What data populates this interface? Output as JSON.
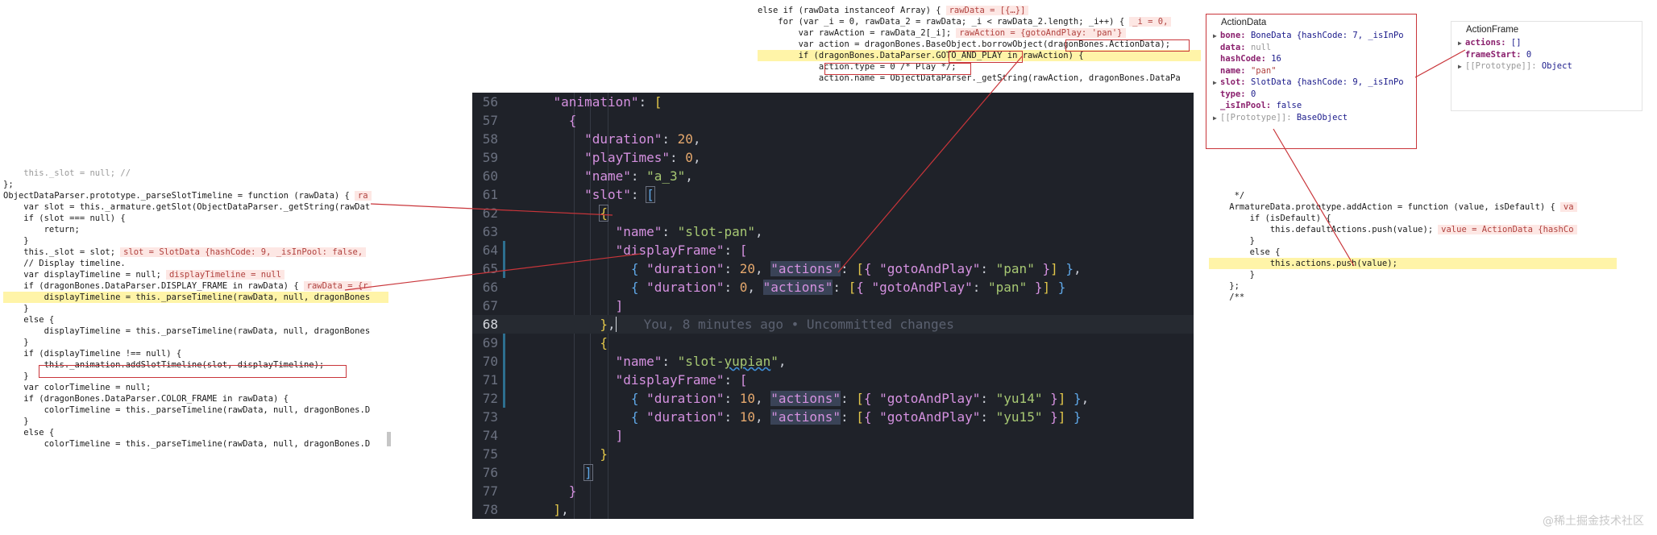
{
  "top_code": {
    "lines": [
      {
        "code": "else if (rawData instanceof Array) {",
        "val": "rawData = [{…}]"
      },
      {
        "code": "    for (var _i = 0, rawData_2 = rawData; _i < rawData_2.length; _i++) {",
        "val": "_i = 0,"
      },
      {
        "code": "        var rawAction = rawData_2[_i];",
        "val": "rawAction = {gotoAndPlay: 'pan'}"
      },
      {
        "code": "        var action = dragonBones.BaseObject.borrowObject(dragonBones.ActionData);",
        "val": ""
      },
      {
        "code": "        if (dragonBones.DataParser.GOTO_AND_PLAY in rawAction) {",
        "val": ""
      },
      {
        "code": "            action.type = 0 /* Play */;",
        "val": ""
      },
      {
        "code": "            action.name = ObjectDataParser._getString(rawAction, dragonBones.DataPa",
        "val": ""
      }
    ]
  },
  "left_code": {
    "lines": [
      {
        "code": "    this._slot = null; //",
        "val": ""
      },
      {
        "code": "};",
        "val": ""
      },
      {
        "code": "ObjectDataParser.prototype._parseSlotTimeline = function (rawData) {",
        "val": "ra"
      },
      {
        "code": "    var slot = this._armature.getSlot(ObjectDataParser._getString(rawDat",
        "val": ""
      },
      {
        "code": "    if (slot === null) {",
        "val": ""
      },
      {
        "code": "        return;",
        "val": ""
      },
      {
        "code": "    }",
        "val": ""
      },
      {
        "code": "    this._slot = slot;",
        "val": "slot = SlotData {hashCode: 9, _isInPool: false,"
      },
      {
        "code": "    // Display timeline.",
        "val": ""
      },
      {
        "code": "    var displayTimeline = null;",
        "val": "displayTimeline = null"
      },
      {
        "code": "    if (dragonBones.DataParser.DISPLAY_FRAME in rawData) {",
        "val": "rawData = {r"
      },
      {
        "code": "        displayTimeline = this._parseTimeline(rawData, null, dragonBones",
        "val": ""
      },
      {
        "code": "    }",
        "val": ""
      },
      {
        "code": "    else {",
        "val": ""
      },
      {
        "code": "        displayTimeline = this._parseTimeline(rawData, null, dragonBones",
        "val": ""
      },
      {
        "code": "    }",
        "val": ""
      },
      {
        "code": "    if (displayTimeline !== null) {",
        "val": ""
      },
      {
        "code": "        this._animation.addSlotTimeline(slot, displayTimeline);",
        "val": ""
      },
      {
        "code": "    }",
        "val": ""
      },
      {
        "code": "    var colorTimeline = null;",
        "val": ""
      },
      {
        "code": "    if (dragonBones.DataParser.COLOR_FRAME in rawData) {",
        "val": ""
      },
      {
        "code": "        colorTimeline = this._parseTimeline(rawData, null, dragonBones.D",
        "val": ""
      },
      {
        "code": "    }",
        "val": ""
      },
      {
        "code": "    else {",
        "val": ""
      },
      {
        "code": "        colorTimeline = this._parseTimeline(rawData, null, dragonBones.D",
        "val": ""
      }
    ]
  },
  "right_code": {
    "lines": [
      {
        "code": "     */",
        "val": ""
      },
      {
        "code": "    ArmatureData.prototype.addAction = function (value, isDefault) {",
        "val": "va"
      },
      {
        "code": "        if (isDefault) {",
        "val": ""
      },
      {
        "code": "            this.defaultActions.push(value);",
        "val": "value = ActionData {hashCo"
      },
      {
        "code": "        }",
        "val": ""
      },
      {
        "code": "        else {",
        "val": ""
      },
      {
        "code": "            this.actions.push(value);",
        "val": ""
      },
      {
        "code": "        }",
        "val": ""
      },
      {
        "code": "    };",
        "val": ""
      },
      {
        "code": "    /**",
        "val": ""
      }
    ]
  },
  "editor": {
    "blame": "You, 8 minutes ago • Uncommitted changes",
    "line_numbers": [
      "56",
      "57",
      "58",
      "59",
      "60",
      "61",
      "62",
      "63",
      "64",
      "65",
      "66",
      "67",
      "68",
      "69",
      "70",
      "71",
      "72",
      "73",
      "74",
      "75",
      "76",
      "77",
      "78"
    ]
  },
  "action_data_popup": {
    "title": "ActionData",
    "rows": [
      {
        "key": "bone",
        "value": "BoneData {hashCode: 7, _isInPo",
        "expandable": true
      },
      {
        "key": "data",
        "value": "null",
        "expandable": false
      },
      {
        "key": "hashCode",
        "value": "16",
        "expandable": false
      },
      {
        "key": "name",
        "value": "\"pan\"",
        "expandable": false
      },
      {
        "key": "slot",
        "value": "SlotData {hashCode: 9, _isInPo",
        "expandable": true
      },
      {
        "key": "type",
        "value": "0",
        "expandable": false
      },
      {
        "key": "_isInPool",
        "value": "false",
        "expandable": false
      },
      {
        "key": "[[Prototype]]",
        "value": "BaseObject",
        "expandable": true
      }
    ]
  },
  "action_frame_popup": {
    "title": "ActionFrame",
    "rows": [
      {
        "key": "actions",
        "value": "[]",
        "expandable": true
      },
      {
        "key": "frameStart",
        "value": "0",
        "expandable": false
      },
      {
        "key": "[[Prototype]]",
        "value": "Object",
        "expandable": true
      }
    ]
  },
  "watermark": "@稀土掘金技术社区"
}
